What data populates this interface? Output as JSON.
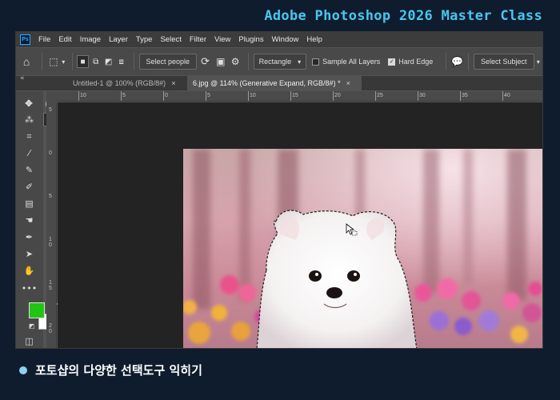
{
  "banner": {
    "title": "Adobe Photoshop 2026 Master Class"
  },
  "menubar": {
    "logo": "Ps",
    "items": [
      "File",
      "Edit",
      "Image",
      "Layer",
      "Type",
      "Select",
      "Filter",
      "View",
      "Plugins",
      "Window",
      "Help"
    ]
  },
  "options": {
    "select_people_label": "Select people",
    "mode_value": "Rectangle",
    "sample_all_layers_label": "Sample All Layers",
    "sample_all_layers_checked": false,
    "hard_edge_label": "Hard Edge",
    "hard_edge_checked": true,
    "select_subject_label": "Select Subject"
  },
  "tabs": [
    {
      "label": "Untitled-1 @ 100% (RGB/8#)",
      "close": "×",
      "active": false
    },
    {
      "label": "6.jpg @ 114% (Generative Expand, RGB/8#) *",
      "close": "×",
      "active": true
    }
  ],
  "ruler": {
    "horizontal": [
      "10",
      "5",
      "0",
      "5",
      "10",
      "15",
      "20",
      "25",
      "30",
      "35",
      "40"
    ],
    "vertical": [
      "5",
      "0",
      "5",
      "1 0",
      "1 5",
      "2 0"
    ]
  },
  "colors": {
    "foreground": "#22c514",
    "background": "#ffffff",
    "accent": "#49c6ef"
  },
  "caption": {
    "text": "포토샵의 다양한 선택도구 익히기"
  }
}
